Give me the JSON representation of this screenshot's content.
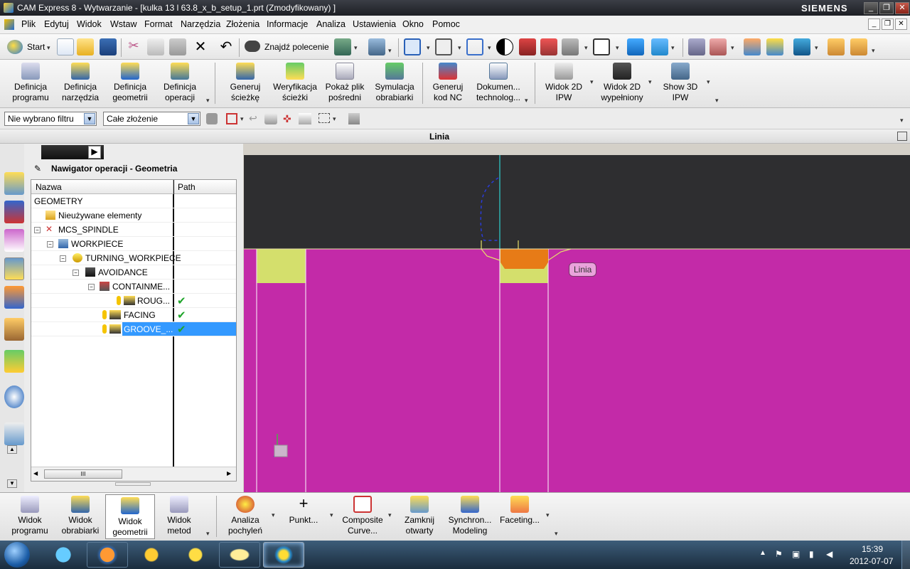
{
  "window": {
    "title": "CAM Express 8 - Wytwarzanie - [kulka 13 l 63.8_x_b_setup_1.prt (Zmodyfikowany) ]",
    "brand": "SIEMENS"
  },
  "menu": [
    "Plik",
    "Edytuj",
    "Widok",
    "Wstaw",
    "Format",
    "Narzędzia",
    "Złożenia",
    "Informacje",
    "Analiza",
    "Ustawienia",
    "Okno",
    "Pomoc"
  ],
  "toolbar1": {
    "start": "Start",
    "find_command": "Znajdź polecenie"
  },
  "toolbar2": {
    "buttons": [
      {
        "l1": "Definicja",
        "l2": "programu"
      },
      {
        "l1": "Definicja",
        "l2": "narzędzia"
      },
      {
        "l1": "Definicja",
        "l2": "geometrii"
      },
      {
        "l1": "Definicja",
        "l2": "operacji"
      },
      {
        "l1": "Generuj",
        "l2": "ścieżkę"
      },
      {
        "l1": "Weryfikacja",
        "l2": "ścieżki"
      },
      {
        "l1": "Pokaż plik",
        "l2": "pośredni"
      },
      {
        "l1": "Symulacja",
        "l2": "obrabiarki"
      },
      {
        "l1": "Generuj",
        "l2": "kod NC"
      },
      {
        "l1": "Dokumen...",
        "l2": "technolog..."
      },
      {
        "l1": "Widok 2D",
        "l2": "IPW"
      },
      {
        "l1": "Widok 2D",
        "l2": "wypełniony"
      },
      {
        "l1": "Show 3D",
        "l2": "IPW"
      }
    ]
  },
  "filter": {
    "type_filter": "Nie wybrano filtru",
    "scope": "Całe złożenie"
  },
  "cue": {
    "label": "Linia"
  },
  "navigator": {
    "title": "Nawigator operacji - Geometria",
    "col_name": "Nazwa",
    "col_path": "Path",
    "rows": [
      {
        "name": "GEOMETRY",
        "check": ""
      },
      {
        "name": "Nieużywane elementy",
        "check": ""
      },
      {
        "name": "MCS_SPINDLE",
        "check": ""
      },
      {
        "name": "WORKPIECE",
        "check": ""
      },
      {
        "name": "TURNING_WORKPIECE",
        "check": ""
      },
      {
        "name": "AVOIDANCE",
        "check": ""
      },
      {
        "name": "CONTAINME...",
        "check": ""
      },
      {
        "name": "ROUG...",
        "check": "✔"
      },
      {
        "name": "FACING",
        "check": "✔"
      },
      {
        "name": "GROOVE_...",
        "check": "✔"
      }
    ],
    "scroll_glyph": "III"
  },
  "viewport": {
    "tooltip": "Linia"
  },
  "bottom": {
    "buttons": [
      {
        "l1": "Widok",
        "l2": "programu"
      },
      {
        "l1": "Widok",
        "l2": "obrabiarki"
      },
      {
        "l1": "Widok",
        "l2": "geometrii"
      },
      {
        "l1": "Widok",
        "l2": "metod"
      },
      {
        "l1": "Analiza",
        "l2": "pochyleń"
      },
      {
        "l1": "Punkt...",
        "l2": ""
      },
      {
        "l1": "Composite",
        "l2": "Curve..."
      },
      {
        "l1": "Zamknij",
        "l2": "otwarty"
      },
      {
        "l1": "Synchron...",
        "l2": "Modeling"
      },
      {
        "l1": "Faceting...",
        "l2": ""
      }
    ]
  },
  "taskbar": {
    "time": "15:39",
    "date": "2012-07-07"
  },
  "colors": {
    "viewport_part": "#c32aa8",
    "viewport_bg": "#2e2e30",
    "stock": "#d4df6c",
    "tool": "#e77b17",
    "selection": "#3399ff"
  }
}
